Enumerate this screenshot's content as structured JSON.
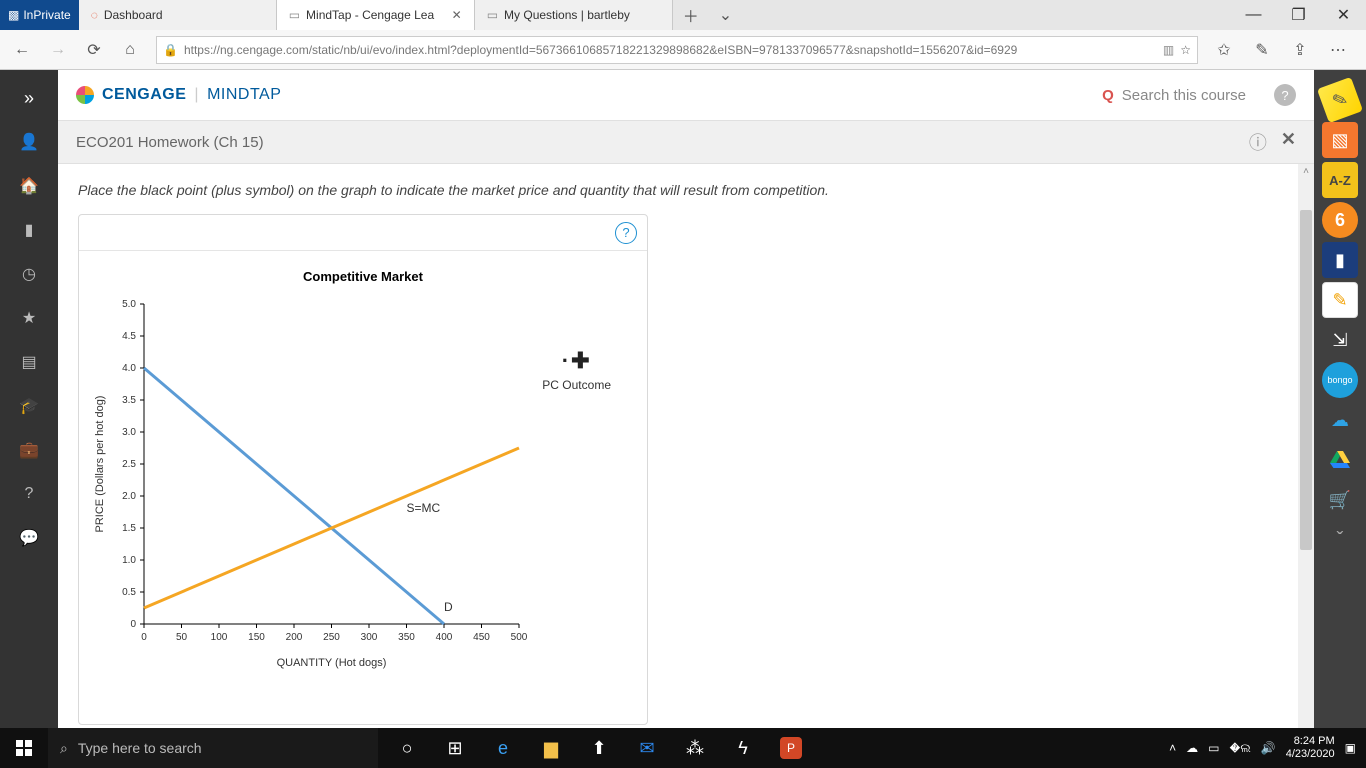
{
  "browser": {
    "inprivate_label": "InPrivate",
    "tabs": [
      {
        "title": "Dashboard",
        "icon_color": "#e24a2b"
      },
      {
        "title": "MindTap - Cengage Lea",
        "icon_color": "#888"
      },
      {
        "title": "My Questions | bartleby",
        "icon_color": "#888"
      }
    ],
    "active_tab_index": 1,
    "url": "https://ng.cengage.com/static/nb/ui/evo/index.html?deploymentId=56736610685718221329898682&eISBN=9781337096577&snapshotId=1556207&id=6929"
  },
  "brand": {
    "name": "CENGAGE",
    "product": "MINDTAP",
    "search_placeholder": "Search this course"
  },
  "assignment": {
    "title": "ECO201 Homework (Ch 15)"
  },
  "instruction": "Place the black point (plus symbol) on the graph to indicate the market price and quantity that will result from competition.",
  "legend": {
    "pc_outcome": "PC Outcome"
  },
  "right_tools": {
    "az": "A-Z",
    "bongo": "bongo"
  },
  "chart_data": {
    "type": "line",
    "title": "Competitive Market",
    "xlabel": "QUANTITY (Hot dogs)",
    "ylabel": "PRICE (Dollars per hot dog)",
    "xlim": [
      0,
      500
    ],
    "ylim": [
      0,
      5.0
    ],
    "x_ticks": [
      0,
      50,
      100,
      150,
      200,
      250,
      300,
      350,
      400,
      450,
      500
    ],
    "y_ticks": [
      0,
      0.5,
      1.0,
      1.5,
      2.0,
      2.5,
      3.0,
      3.5,
      4.0,
      4.5,
      5.0
    ],
    "series": [
      {
        "name": "D",
        "color": "#5b9bd5",
        "points": [
          [
            0,
            4.0
          ],
          [
            400,
            0.0
          ]
        ]
      },
      {
        "name": "S=MC",
        "color": "#f5a623",
        "points": [
          [
            0,
            0.25
          ],
          [
            500,
            2.75
          ]
        ]
      }
    ],
    "series_label_positions": {
      "D": [
        400,
        0.2
      ],
      "S=MC": [
        350,
        1.75
      ]
    }
  },
  "taskbar": {
    "search_placeholder": "Type here to search",
    "time": "8:24 PM",
    "date": "4/23/2020"
  }
}
